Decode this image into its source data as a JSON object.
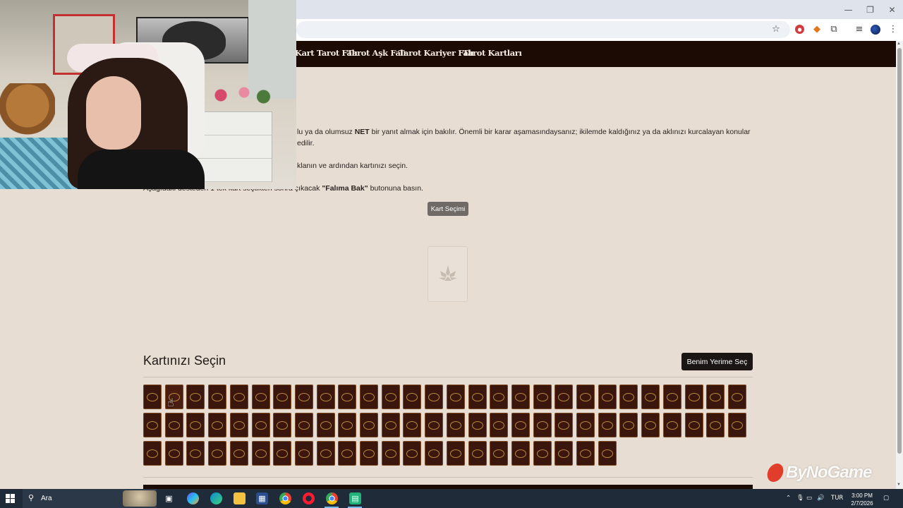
{
  "browser": {
    "window_controls": {
      "minimize": "—",
      "restore": "❐",
      "close": "✕"
    },
    "toolbar_icons": [
      "star-icon",
      "extension-red-icon",
      "metamask-icon",
      "extensions-puzzle-icon",
      "media-queue-icon",
      "profile-avatar",
      "more-menu-icon"
    ]
  },
  "site_nav": {
    "items": [
      "Kart Tarot Falı",
      "Tarot Aşk Falı",
      "Tarot Kariyer Falı",
      "Tarot Kartları"
    ]
  },
  "intro": {
    "line1_pre": "lu ya da olumsuz ",
    "line1_bold": "NET",
    "line1_post": " bir yanıt almak için bakılır. Önemli bir karar aşamasındaysanız; ikilemde kaldığınız ya da aklınızı kurcalayan konular",
    "line2": "edilir.",
    "line3": "klanın ve ardından kartınızı seçin.",
    "line4_pre": "Aşağıdaki desteden 1 tek kart seçtikten sonra çıkacak ",
    "line4_bold": "\"Falıma Bak\"",
    "line4_post": " butonuna basın."
  },
  "kart_secimi_button": "Kart Seçimi",
  "section": {
    "title": "Kartınızı Seçin",
    "choose_for_me_button": "Benim Yerime Seç"
  },
  "deck": {
    "rows": [
      28,
      28,
      22
    ]
  },
  "watermark": "ByNoGame",
  "taskbar": {
    "search_placeholder": "Ara",
    "language": "TUR",
    "time": "3:00 PM",
    "date": "2/7/2026"
  }
}
